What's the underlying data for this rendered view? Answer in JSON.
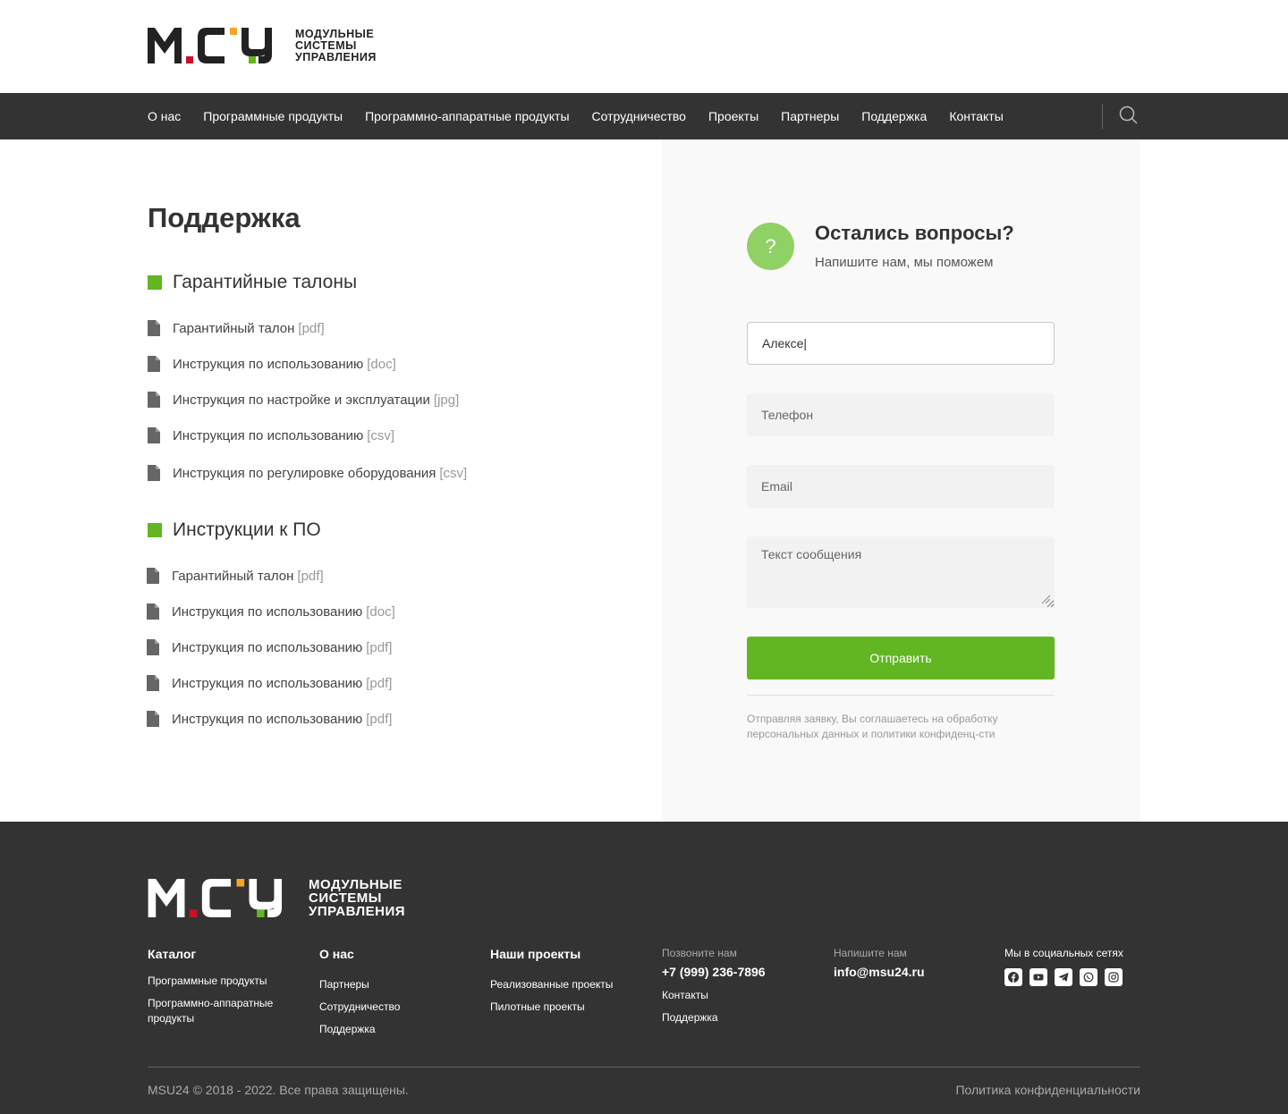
{
  "brand": {
    "logo_letters": "MCY",
    "logo_lines": [
      "МОДУЛЬНЫЕ",
      "СИСТЕМЫ",
      "УПРАВЛЕНИЯ"
    ],
    "colors": {
      "green": "#62b622",
      "orange": "#f5a623",
      "red": "#c8102e",
      "dark": "#333333"
    }
  },
  "nav": {
    "items": [
      "О нас",
      "Программные продукты",
      "Программно-аппаратные продукты",
      "Сотрудничество",
      "Проекты",
      "Партнеры",
      "Поддержка",
      "Контакты"
    ],
    "search_icon": "search-icon"
  },
  "page": {
    "title": "Поддержка",
    "sections": [
      {
        "title": "Гарантийные талоны",
        "docs": [
          {
            "name": "Гарантийный талон",
            "ext": "[pdf]"
          },
          {
            "name": "Инструкция по использованию",
            "ext": "[doc]"
          },
          {
            "name": "Инструкция по настройке и эксплуатации",
            "ext": "[jpg]"
          },
          {
            "name": "Инструкция по использованию",
            "ext": "[csv]"
          },
          {
            "name": "Инструкция по регулировке оборудования",
            "ext": "[csv]"
          }
        ]
      },
      {
        "title": "Инструкции к ПО",
        "docs": [
          {
            "name": "Гарантийный талон",
            "ext": "[pdf]"
          },
          {
            "name": "Инструкция по использованию",
            "ext": "[doc]"
          },
          {
            "name": "Инструкция по использованию",
            "ext": "[pdf]"
          },
          {
            "name": "Инструкция по использованию",
            "ext": "[pdf]"
          },
          {
            "name": "Инструкция по использованию",
            "ext": "[pdf]"
          }
        ]
      }
    ]
  },
  "form": {
    "icon_glyph": "?",
    "title": "Остались вопросы?",
    "subtitle": "Напишите нам, мы поможем",
    "name_value": "Алексе|",
    "phone_placeholder": "Телефон",
    "email_placeholder": "Email",
    "message_placeholder": "Текст сообщения",
    "submit_label": "Отправить",
    "consent": "Отправляя заявку, Вы соглашаетесь на обработку персональных данных и политики конфиденц-сти"
  },
  "footer": {
    "catalog": {
      "title": "Каталог",
      "links": [
        "Программные продукты",
        "Программно-аппаратные продукты"
      ]
    },
    "about": {
      "title": "О нас",
      "links": [
        "Партнеры",
        "Сотрудничество",
        "Поддержка"
      ]
    },
    "projects": {
      "title": "Наши проекты",
      "links": [
        "Реализованные проекты",
        "Пилотные проекты"
      ]
    },
    "call": {
      "label": "Позвоните нам",
      "phone": "+7 (999) 236-7896",
      "links": [
        "Контакты",
        "Поддержка"
      ]
    },
    "write": {
      "label": "Напишите нам",
      "email": "info@msu24.ru"
    },
    "social": {
      "label": "Мы в социальных сетях",
      "icons": [
        "facebook-icon",
        "youtube-icon",
        "telegram-icon",
        "whatsapp-icon",
        "instagram-icon"
      ]
    },
    "copyright": "MSU24 © 2018 - 2022. Все права защищены.",
    "privacy": "Политика конфиденциальности"
  }
}
